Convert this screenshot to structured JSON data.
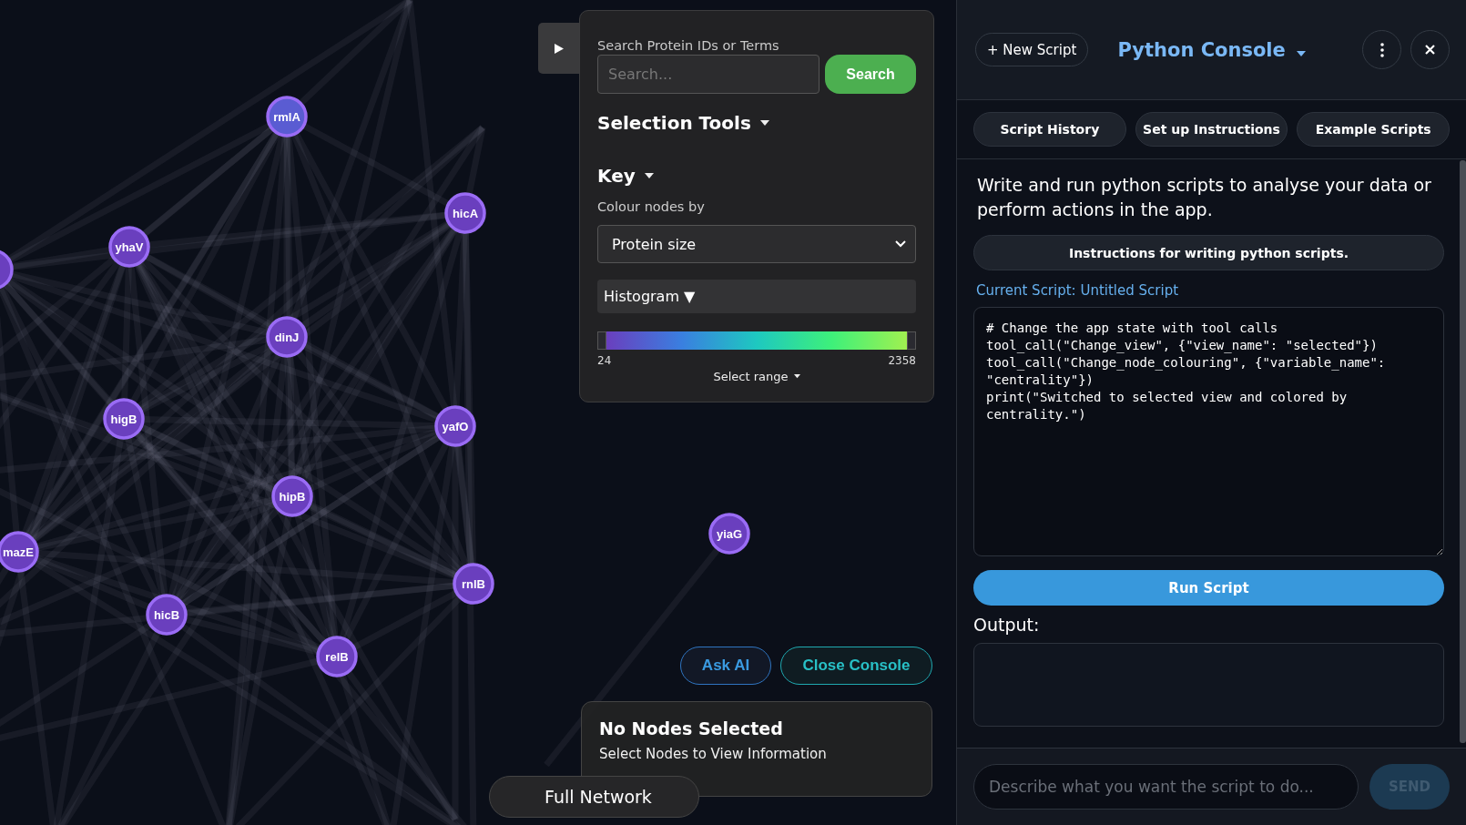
{
  "network": {
    "nodes": [
      {
        "label": "rmlA",
        "color": "#5a5cd2"
      },
      {
        "label": "hicA",
        "color": "#6a3fbe"
      },
      {
        "label": "yhaV",
        "color": "#6a3fbe"
      },
      {
        "label": "dinJ",
        "color": "#6a3fbe"
      },
      {
        "label": "higB",
        "color": "#6a3fbe"
      },
      {
        "label": "yafO",
        "color": "#6a3fbe"
      },
      {
        "label": "hipB",
        "color": "#6a3fbe"
      },
      {
        "label": "mazE",
        "color": "#6a3fbe"
      },
      {
        "label": "yiaG",
        "color": "#6a3fbe"
      },
      {
        "label": "rnlB",
        "color": "#6a3fbe"
      },
      {
        "label": "hicB",
        "color": "#6a3fbe"
      },
      {
        "label": "relB",
        "color": "#6a3fbe"
      },
      {
        "color": "#6a3fbe"
      }
    ],
    "view_button": "Full Network",
    "ask_button": "Ask AI",
    "close_console_button": "Close Console"
  },
  "control_panel": {
    "search_label": "Search Protein IDs or Terms",
    "search_placeholder": "Search...",
    "search_button": "Search",
    "selection_tools": "Selection Tools",
    "key": "Key",
    "colour_label": "Colour nodes by",
    "colour_select": "Protein size",
    "histogram": {
      "label": "Histogram",
      "arrow": "▼"
    },
    "range_min": "24",
    "range_max": "2358",
    "select_range": "Select range"
  },
  "info_panel": {
    "title": "No Nodes Selected",
    "text": "Select Nodes to View Information"
  },
  "console": {
    "new_script": "+ New Script",
    "title": "Python Console",
    "tabs": [
      {
        "label": "Script History"
      },
      {
        "label": "Set up Instructions"
      },
      {
        "label": "Example Scripts"
      }
    ],
    "intro": "Write and run python scripts to analyse your data or perform actions in the app.",
    "instructions_button": "Instructions for writing python scripts.",
    "current_script": "Current Script: Untitled Script",
    "code": "# Change the app state with tool calls\ntool_call(\"Change_view\", {\"view_name\": \"selected\"})\ntool_call(\"Change_node_colouring\", {\"variable_name\": \"centrality\"})\nprint(\"Switched to selected view and colored by centrality.\")",
    "run_button": "Run Script",
    "output_label": "Output:",
    "prompt_placeholder": "Describe what you want the script to do...",
    "send_button": "SEND"
  }
}
